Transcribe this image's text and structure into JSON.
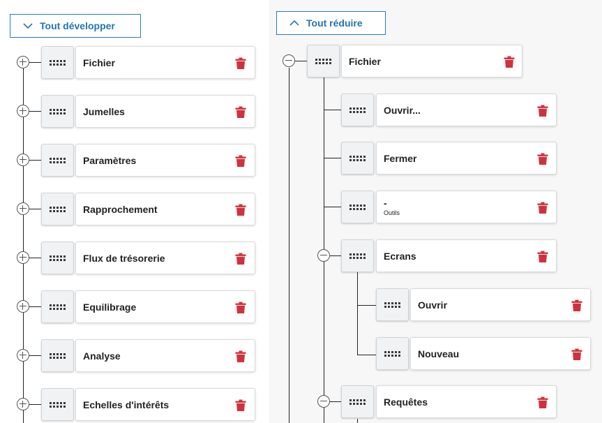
{
  "left": {
    "toggle_button": {
      "label": "Tout développer",
      "icon": "chevron-down-icon"
    },
    "items": [
      {
        "label": "Fichier"
      },
      {
        "label": "Jumelles"
      },
      {
        "label": "Paramètres"
      },
      {
        "label": "Rapprochement"
      },
      {
        "label": "Flux de trésorerie"
      },
      {
        "label": "Equilibrage"
      },
      {
        "label": "Analyse"
      },
      {
        "label": "Echelles d'intérêts"
      }
    ]
  },
  "right": {
    "toggle_button": {
      "label": "Tout réduire",
      "icon": "chevron-up-icon"
    },
    "root": {
      "label": "Fichier"
    },
    "children": [
      {
        "label": "Ouvrir..."
      },
      {
        "label": "Fermer"
      },
      {
        "label": "-",
        "sublabel": "Outils"
      },
      {
        "label": "Ecrans"
      },
      {
        "label": "Requêtes"
      }
    ],
    "grandchildren": [
      {
        "label": "Ouvrir"
      },
      {
        "label": "Nouveau"
      }
    ]
  },
  "colors": {
    "accent": "#2474b1",
    "delete": "#d0313f",
    "connector": "#222222"
  }
}
